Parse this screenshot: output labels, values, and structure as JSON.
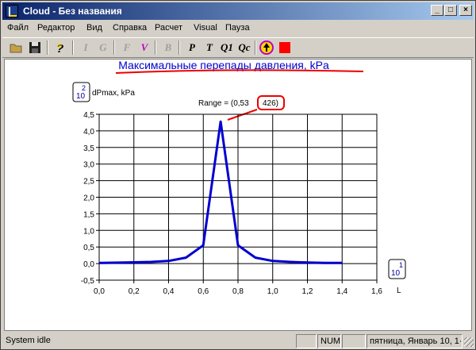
{
  "window": {
    "title": "Cloud - Без названия",
    "controls": [
      "_",
      "□",
      "×"
    ]
  },
  "menu": [
    "Файл",
    "Редактор",
    "Вид",
    "Справка",
    "Расчет",
    "Visual",
    "Пауза"
  ],
  "toolbar": {
    "labels": [
      "I",
      "G",
      "F",
      "V",
      "B",
      "P",
      "T",
      "Q1",
      "Qc"
    ]
  },
  "plot": {
    "heading": "Максимальные перепады давления, kPa",
    "y_exponent": "2",
    "x_exponent": "1",
    "range_text": "Range = (0,53",
    "range_highlight": "426)",
    "exp_base": "10"
  },
  "chart_data": {
    "type": "line",
    "title": "Максимальные перепады давления, kPa",
    "ylabel": "dPmax, kPa",
    "xlabel": "L",
    "xlim": [
      0,
      1.6
    ],
    "ylim": [
      -0.5,
      4.5
    ],
    "x_ticks": [
      "0,0",
      "0,2",
      "0,4",
      "0,6",
      "0,8",
      "1,0",
      "1,2",
      "1,4",
      "1,6"
    ],
    "y_ticks": [
      "-0,5",
      "0,0",
      "0,5",
      "1,0",
      "1,5",
      "2,0",
      "2,5",
      "3,0",
      "3,5",
      "4,0",
      "4,5"
    ],
    "grid": true,
    "series": [
      {
        "color": "#0000d0",
        "x": [
          0.0,
          0.15,
          0.3,
          0.4,
          0.5,
          0.6,
          0.7,
          0.8,
          0.9,
          1.0,
          1.1,
          1.2,
          1.3,
          1.4
        ],
        "y": [
          0.02,
          0.03,
          0.05,
          0.08,
          0.18,
          0.55,
          4.28,
          0.55,
          0.18,
          0.08,
          0.05,
          0.03,
          0.02,
          0.02
        ]
      }
    ]
  },
  "status": {
    "text": "System idle",
    "num": "NUM",
    "date": "пятница, Январь 10, 1·"
  }
}
